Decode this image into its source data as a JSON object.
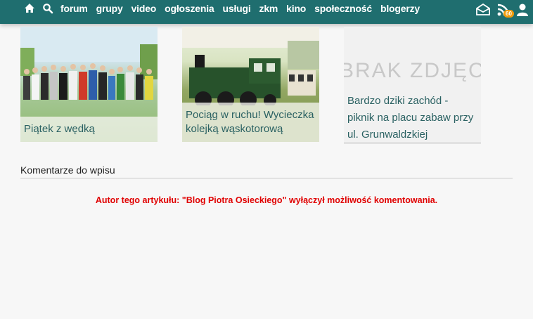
{
  "nav": {
    "items": [
      "forum",
      "grupy",
      "video",
      "ogłoszenia",
      "usługi",
      "zkm",
      "kino",
      "społeczność",
      "blogerzy"
    ],
    "icons": [
      "home-icon",
      "search-icon"
    ]
  },
  "header_right": {
    "rss_count": "60",
    "icons": [
      "envelope-icon",
      "rss-icon",
      "user-icon"
    ]
  },
  "related": [
    {
      "title": "Piątek z wędką"
    },
    {
      "title": "Pociąg w ruchu! Wycieczka kolejką wąskotorową"
    },
    {
      "title": "Bardzo dziki zachód - piknik na placu zabaw przy ul. Grunwaldzkiej",
      "placeholder": "BRAK ZDJĘCIA"
    }
  ],
  "comments": {
    "title": "Komentarze do wpisu",
    "notice": "Autor tego artykułu: \"Blog Piotra Osieckiego\" wyłączył możliwość komentowania."
  },
  "colors": {
    "topbar": "#1f6e6f",
    "link": "#2a6162",
    "notice": "#e00000"
  }
}
